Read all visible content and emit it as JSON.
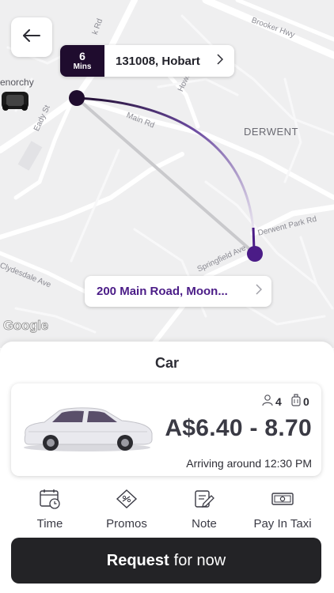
{
  "map": {
    "labels": {
      "brooker_hwy": "Brooker Hwy",
      "k_rd": "k Rd",
      "glenorchy": "enorchy",
      "eady_st": "Eady St",
      "main_rd": "Main Rd",
      "howard": "Howa",
      "derwent": "DERWENT",
      "derwent_park_rd": "Derwent Park Rd",
      "springfield_ave": "Springfield Ave",
      "clydesdale_ave": "Clydesdale Ave"
    },
    "google_logo": "Google"
  },
  "origin_chip": {
    "eta_number": "6",
    "eta_unit": "Mins",
    "address": "131008, Hobart"
  },
  "destination_chip": {
    "address": "200 Main Road, Moon..."
  },
  "sheet": {
    "title": "Car",
    "ride": {
      "passengers": "4",
      "luggage": "0",
      "price": "A$6.40 - 8.70",
      "arrival": "Arriving around 12:30 PM"
    },
    "options": [
      {
        "label": "Time",
        "icon": "calendar-clock-icon"
      },
      {
        "label": "Promos",
        "icon": "promo-tag-icon"
      },
      {
        "label": "Note",
        "icon": "note-pencil-icon"
      },
      {
        "label": "Pay In Taxi",
        "icon": "cash-icon"
      }
    ],
    "request": {
      "bold": "Request",
      "rest": "for now"
    }
  },
  "colors": {
    "accent": "#4b1c87",
    "eta_bg": "#1f0c2e",
    "button_bg": "#232326"
  }
}
